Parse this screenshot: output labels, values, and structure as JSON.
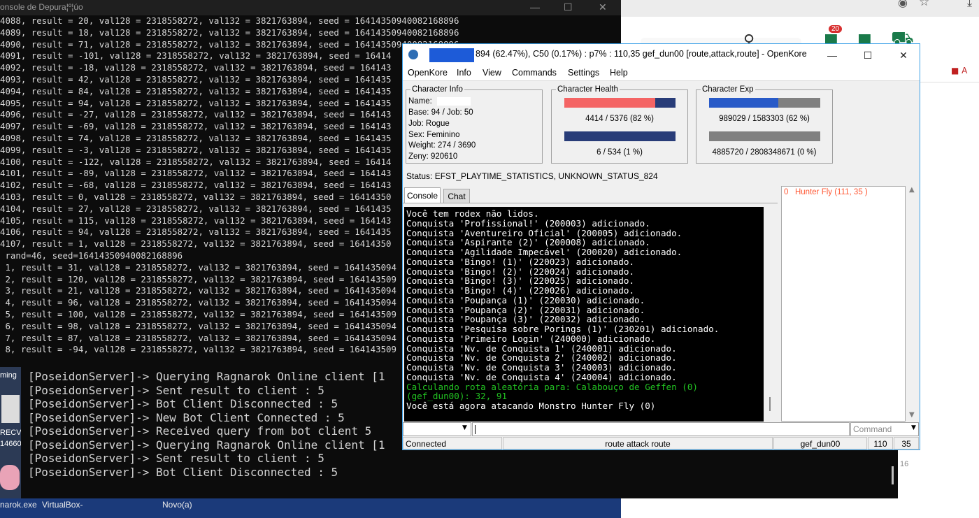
{
  "debug_console": {
    "title": "onsole de Depura¦º¦úo",
    "lines": [
      "4088, result = 20, val128 = 2318558272, val132 = 3821763894, seed = 16414350940082168896",
      "4089, result = 18, val128 = 2318558272, val132 = 3821763894, seed = 16414350940082168896",
      "4090, result = 71, val128 = 2318558272, val132 = 3821763894, seed = 16414350940082168896",
      "4091, result = -101, val128 = 2318558272, val132 = 3821763894, seed = 16414",
      "4092, result = -18, val128 = 2318558272, val132 = 3821763894, seed = 164143",
      "4093, result = 42, val128 = 2318558272, val132 = 3821763894, seed = 1641435",
      "4094, result = 84, val128 = 2318558272, val132 = 3821763894, seed = 1641435",
      "4095, result = 94, val128 = 2318558272, val132 = 3821763894, seed = 1641435",
      "4096, result = -27, val128 = 2318558272, val132 = 3821763894, seed = 164143",
      "4097, result = -69, val128 = 2318558272, val132 = 3821763894, seed = 164143",
      "4098, result = 74, val128 = 2318558272, val132 = 3821763894, seed = 1641435",
      "4099, result = -3, val128 = 2318558272, val132 = 3821763894, seed = 1641435",
      "4100, result = -122, val128 = 2318558272, val132 = 3821763894, seed = 16414",
      "4101, result = -89, val128 = 2318558272, val132 = 3821763894, seed = 164143",
      "4102, result = -68, val128 = 2318558272, val132 = 3821763894, seed = 164143",
      "4103, result = 0, val128 = 2318558272, val132 = 3821763894, seed = 16414350",
      "4104, result = 27, val128 = 2318558272, val132 = 3821763894, seed = 1641435",
      "4105, result = 115, val128 = 2318558272, val132 = 3821763894, seed = 164143",
      "4106, result = 94, val128 = 2318558272, val132 = 3821763894, seed = 1641435",
      "4107, result = 1, val128 = 2318558272, val132 = 3821763894, seed = 16414350",
      " rand=46, seed=16414350940082168896",
      " 1, result = 31, val128 = 2318558272, val132 = 3821763894, seed = 1641435094",
      " 2, result = 120, val128 = 2318558272, val132 = 3821763894, seed = 164143509",
      " 3, result = 21, val128 = 2318558272, val132 = 3821763894, seed = 1641435094",
      " 4, result = 96, val128 = 2318558272, val132 = 3821763894, seed = 1641435094",
      " 5, result = 100, val128 = 2318558272, val132 = 3821763894, seed = 164143509",
      " 6, result = 98, val128 = 2318558272, val132 = 3821763894, seed = 1641435094",
      " 7, result = 87, val128 = 2318558272, val132 = 3821763894, seed = 1641435094",
      " 8, result = -94, val128 = 2318558272, val132 = 3821763894, seed = 164143509"
    ]
  },
  "poseidon_console": {
    "lines": [
      "[PoseidonServer]-> Querying Ragnarok Online client [1",
      "[PoseidonServer]-> Sent result to client : 5",
      "[PoseidonServer]-> Bot Client Disconnected : 5",
      "[PoseidonServer]-> New Bot Client Connected : 5",
      "[PoseidonServer]-> Received query from bot client 5",
      "[PoseidonServer]-> Querying Ragnarok Online client [1",
      "[PoseidonServer]-> Sent result to client : 5",
      "[PoseidonServer]-> Bot Client Disconnected : 5"
    ]
  },
  "desktop": {
    "labels": [
      "ming",
      "RECV",
      "14660"
    ],
    "taskbar_items": [
      "narok.exe",
      "VirtualBox-",
      "Novo(a)"
    ],
    "side_number": "16"
  },
  "browser": {
    "cart_badge": "20"
  },
  "openkore": {
    "title": "894 (62.47%), C50 (0.17%) : p7% : 110,35 gef_dun00 [route,attack,route] - OpenKore",
    "menu": [
      "OpenKore",
      "Info",
      "View",
      "Commands",
      "Settings",
      "Help"
    ],
    "character_info": {
      "legend": "Character Info",
      "name": "Name:",
      "base_job": "Base: 94 / Job: 50",
      "job": "Job: Rogue",
      "sex": "Sex: Feminino",
      "weight": "Weight: 274 / 3690",
      "zeny": "Zeny: 920610"
    },
    "health": {
      "legend": "Character Health",
      "hp_text": "4414 / 5376 (82 %)",
      "hp_fraction": 0.82,
      "sp_text": "6 / 534 (1 %)",
      "sp_fraction": 0.01
    },
    "exp": {
      "legend": "Character Exp",
      "base_text": "989029 / 1583303 (62 %)",
      "base_fraction": 0.62,
      "job_text": "4885720 / 2808348671 (0 %)",
      "job_fraction": 0.0
    },
    "status_line": "Status: EFST_PLAYTIME_STATISTICS, UNKNOWN_STATUS_824",
    "tabs": [
      "Console",
      "Chat"
    ],
    "console_lines": [
      {
        "text": "Você tem rodex não lidos.",
        "color": "#ffffff"
      },
      {
        "text": "Conquista 'Profissional!' (200003) adicionado.",
        "color": "#ffffff"
      },
      {
        "text": "Conquista 'Aventureiro Oficial' (200005) adicionado.",
        "color": "#ffffff"
      },
      {
        "text": "Conquista 'Aspirante (2)' (200008) adicionado.",
        "color": "#ffffff"
      },
      {
        "text": "Conquista 'Agilidade Impecável' (200020) adicionado.",
        "color": "#ffffff"
      },
      {
        "text": "Conquista 'Bingo! (1)' (220023) adicionado.",
        "color": "#ffffff"
      },
      {
        "text": "Conquista 'Bingo! (2)' (220024) adicionado.",
        "color": "#ffffff"
      },
      {
        "text": "Conquista 'Bingo! (3)' (220025) adicionado.",
        "color": "#ffffff"
      },
      {
        "text": "Conquista 'Bingo! (4)' (220026) adicionado.",
        "color": "#ffffff"
      },
      {
        "text": "Conquista 'Poupança (1)' (220030) adicionado.",
        "color": "#ffffff"
      },
      {
        "text": "Conquista 'Poupança (2)' (220031) adicionado.",
        "color": "#ffffff"
      },
      {
        "text": "Conquista 'Poupança (3)' (220032) adicionado.",
        "color": "#ffffff"
      },
      {
        "text": "Conquista 'Pesquisa sobre Porings (1)' (230201) adicionado.",
        "color": "#ffffff"
      },
      {
        "text": "Conquista 'Primeiro Login' (240000) adicionado.",
        "color": "#ffffff"
      },
      {
        "text": "Conquista 'Nv. de Conquista 1' (240001) adicionado.",
        "color": "#ffffff"
      },
      {
        "text": "Conquista 'Nv. de Conquista 2' (240002) adicionado.",
        "color": "#ffffff"
      },
      {
        "text": "Conquista 'Nv. de Conquista 3' (240003) adicionado.",
        "color": "#ffffff"
      },
      {
        "text": "Conquista 'Nv. de Conquista 4' (240004) adicionado.",
        "color": "#ffffff"
      },
      {
        "text": "Calculando rota aleatória para: Calabouço de Geffen (0)",
        "color": "#22c322"
      },
      {
        "text": "(gef_dun00): 32, 91",
        "color": "#22c322"
      },
      {
        "text": "Você está agora atacando Monstro Hunter Fly (0)",
        "color": "#ffffff"
      }
    ],
    "monster_list": [
      "0   Hunter Fly (111, 35 )"
    ],
    "command_placeholder": "Command",
    "statusbar": {
      "connection": "Connected",
      "ai": "route attack route",
      "map": "gef_dun00",
      "x": "110",
      "y": "35"
    },
    "colors": {
      "hp": "#f46464",
      "sp": "#283c78",
      "base_exp": "#285ac8",
      "bar_bg": "#808080",
      "hp_bg": "#283c78"
    }
  }
}
